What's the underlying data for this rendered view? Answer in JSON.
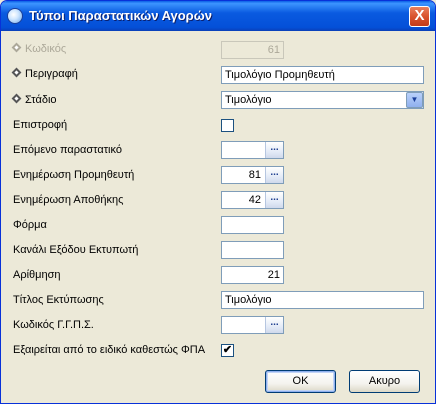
{
  "window": {
    "title": "Τύποι Παραστατικών Αγορών",
    "close_label": "X"
  },
  "fields": {
    "code": {
      "label": "Κωδικός",
      "value": "61"
    },
    "description": {
      "label": "Περιγραφή",
      "value": "Τιμολόγιο Προμηθευτή"
    },
    "stage": {
      "label": "Στάδιο",
      "value": "Τιμολόγιο"
    },
    "return": {
      "label": "Επιστροφή",
      "checked": false
    },
    "next_document": {
      "label": "Επόμενο παραστατικό",
      "value": ""
    },
    "supplier_update": {
      "label": "Ενημέρωση Προμηθευτή",
      "value": "81"
    },
    "warehouse_update": {
      "label": "Ενημέρωση Αποθήκης",
      "value": "42"
    },
    "form": {
      "label": "Φόρμα",
      "value": ""
    },
    "printer_channel": {
      "label": "Κανάλι Εξόδου Εκτυπωτή",
      "value": ""
    },
    "numbering": {
      "label": "Αρίθμηση",
      "value": "21"
    },
    "print_title": {
      "label": "Τίτλος Εκτύπωσης",
      "value": "Τιμολόγιο"
    },
    "gps_code": {
      "label": "Κωδικός Γ.Γ.Π.Σ.",
      "value": ""
    },
    "vat_exempt": {
      "label": "Εξαιρείται από το ειδικό καθεστώς ΦΠΑ",
      "checked": true
    }
  },
  "icons": {
    "lookup": "...",
    "dropdown": "▼",
    "check": "✔"
  },
  "buttons": {
    "ok": "OK",
    "cancel": "Ακυρο"
  }
}
